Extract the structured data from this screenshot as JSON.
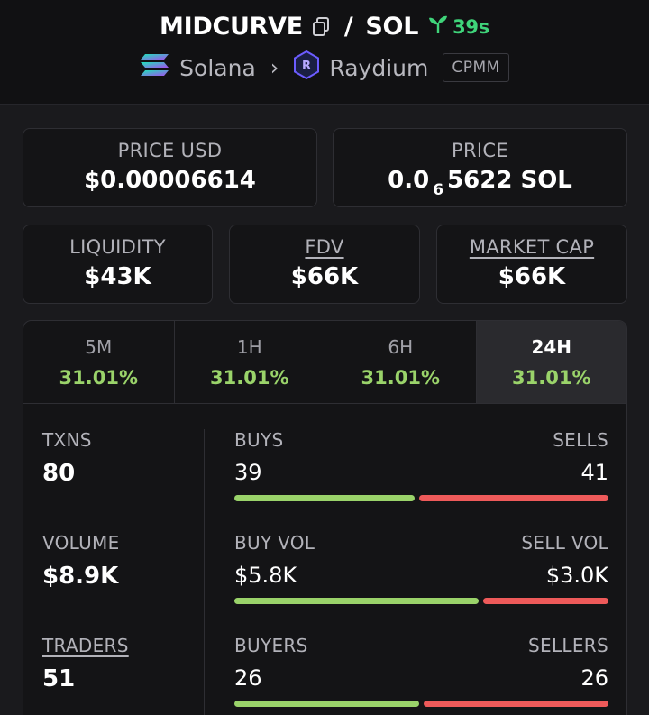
{
  "header": {
    "token_symbol": "MIDCURVE",
    "separator": "/",
    "quote_symbol": "SOL",
    "age": "39s",
    "chain": "Solana",
    "dex": "Raydium",
    "pool_type": "CPMM",
    "icons": {
      "copy": "copy-icon",
      "age": "sprout-icon",
      "chain": "solana-logo",
      "dex": "raydium-logo",
      "chevron": "chevron-right-icon"
    },
    "colors": {
      "age": "#3fd47a"
    }
  },
  "cards": {
    "price_usd": {
      "label": "PRICE USD",
      "value": "$0.00006614"
    },
    "price": {
      "label": "PRICE",
      "value_prefix": "0.0",
      "value_subscript": "6",
      "value_suffix": "5622 SOL"
    },
    "liquidity": {
      "label": "LIQUIDITY",
      "value": "$43K"
    },
    "fdv": {
      "label": "FDV",
      "value": "$66K"
    },
    "market_cap": {
      "label": "MARKET CAP",
      "value": "$66K"
    }
  },
  "tabs": [
    {
      "label": "5M",
      "value": "31.01%"
    },
    {
      "label": "1H",
      "value": "31.01%"
    },
    {
      "label": "6H",
      "value": "31.01%"
    },
    {
      "label": "24H",
      "value": "31.01%",
      "active": true
    }
  ],
  "stats": {
    "txns": {
      "label": "TXNS",
      "value": "80"
    },
    "volume": {
      "label": "VOLUME",
      "value": "$8.9K"
    },
    "traders": {
      "label": "TRADERS",
      "value": "51"
    },
    "buys_sells": {
      "left_label": "BUYS",
      "right_label": "SELLS",
      "left_value": "39",
      "right_value": "41",
      "left_fraction": 0.488
    },
    "buy_sell_vol": {
      "left_label": "BUY VOL",
      "right_label": "SELL VOL",
      "left_value": "$5.8K",
      "right_value": "$3.0K",
      "left_fraction": 0.66
    },
    "buyers_sellers": {
      "left_label": "BUYERS",
      "right_label": "SELLERS",
      "left_value": "26",
      "right_value": "26",
      "left_fraction": 0.5
    }
  },
  "colors": {
    "positive": "#9ad36a",
    "negative": "#ee5a5a"
  }
}
